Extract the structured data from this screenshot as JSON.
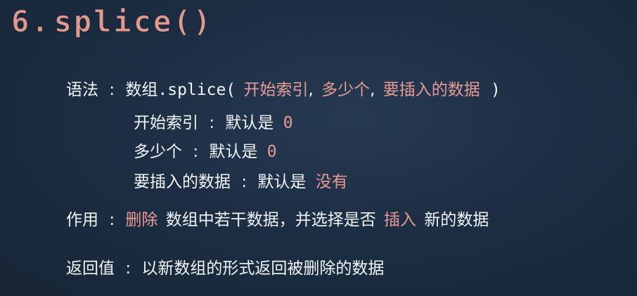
{
  "title": {
    "number": "6.",
    "name": "splice()"
  },
  "syntax": {
    "label": "语法",
    "colon": ":",
    "prefix": "数组.splice(",
    "param1": "开始索引",
    "comma1": ",",
    "param2": "多少个",
    "comma2": ",",
    "param3": "要插入的数据",
    "suffix": ")"
  },
  "params": [
    {
      "name": "开始索引",
      "colon": ":",
      "text": "默认是",
      "value": "0"
    },
    {
      "name": "多少个",
      "colon": ":",
      "text": "默认是",
      "value": "0"
    },
    {
      "name": "要插入的数据",
      "colon": ":",
      "text": "默认是",
      "value": "没有"
    }
  ],
  "effect": {
    "label": "作用",
    "colon": ":",
    "highlight1": "删除",
    "text1": "数组中若干数据，并选择是否",
    "highlight2": "插入",
    "text2": "新的数据"
  },
  "returns": {
    "label": "返回值",
    "colon": ":",
    "text": "以新数组的形式返回被删除的数据"
  }
}
